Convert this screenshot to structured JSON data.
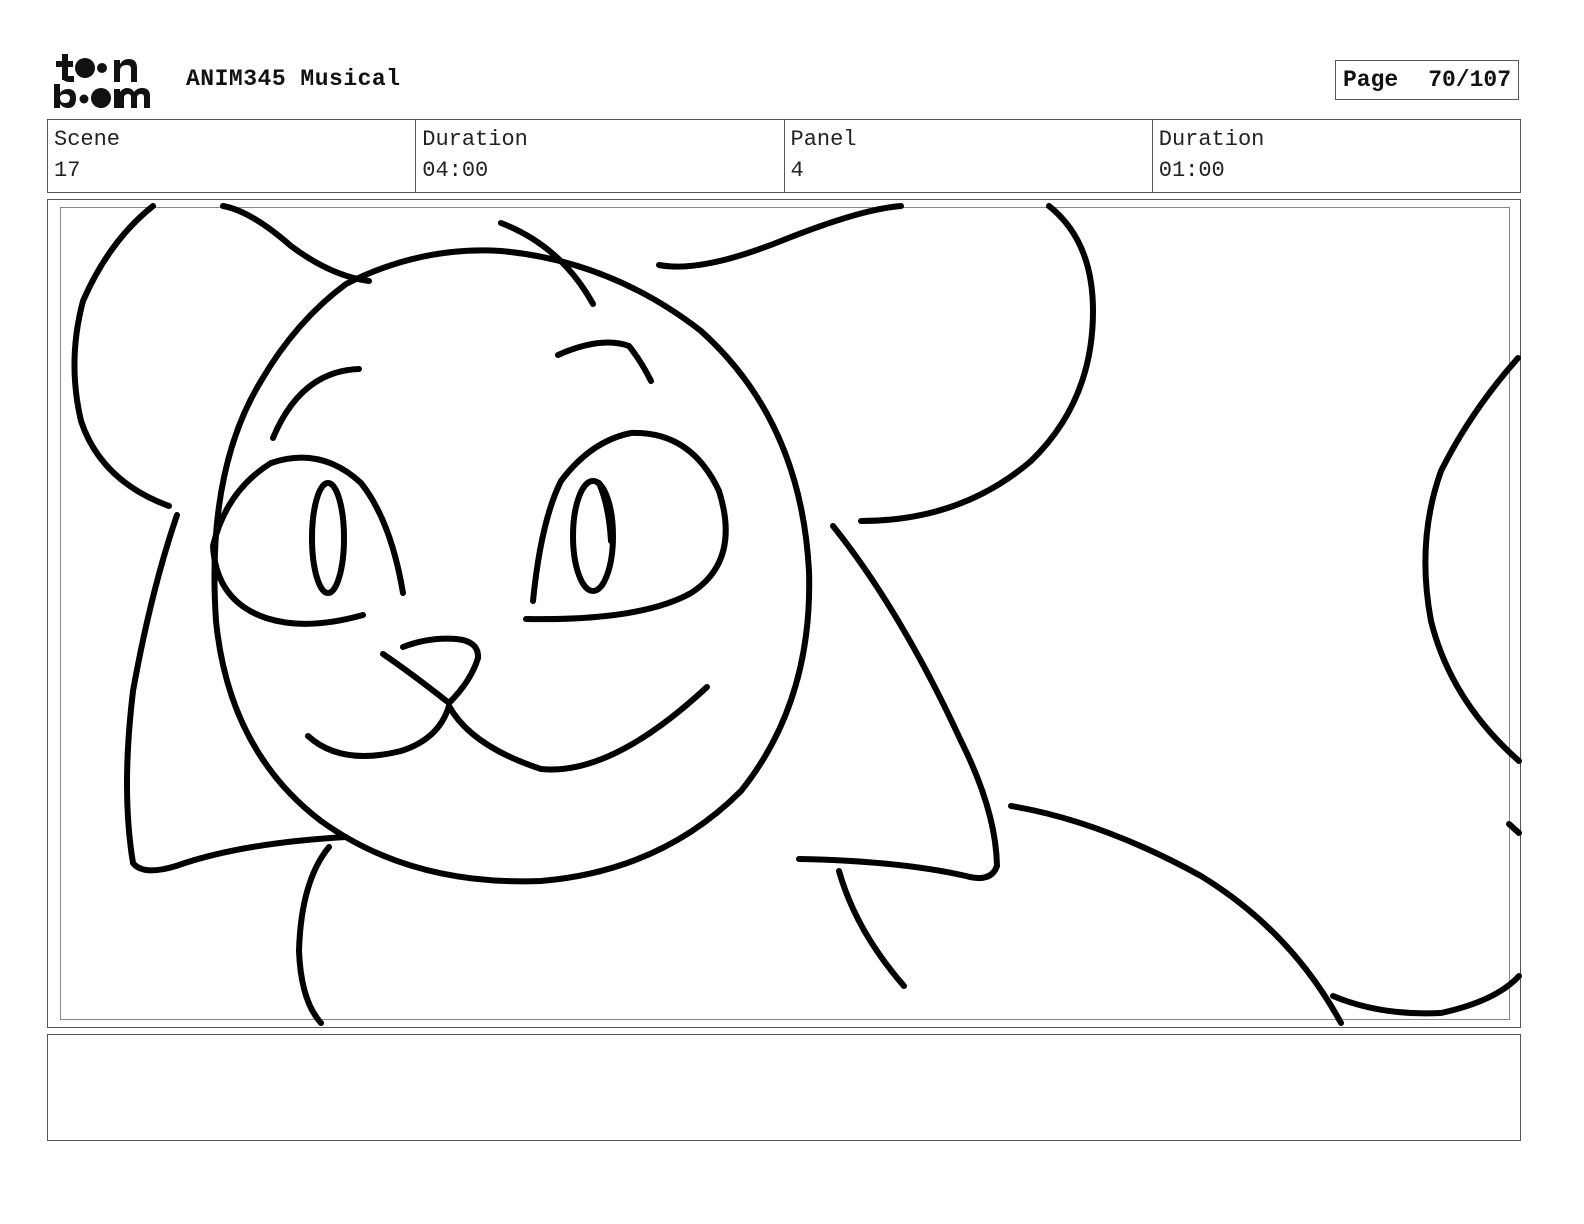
{
  "header": {
    "logo_top": "t  n",
    "logo_bottom": "b  m",
    "project_title": "ANIM345 Musical",
    "page_label": "Page",
    "page_number": "70/107"
  },
  "info": {
    "scene_label": "Scene",
    "scene_value": "17",
    "scene_duration_label": "Duration",
    "scene_duration_value": "04:00",
    "panel_label": "Panel",
    "panel_value": "4",
    "panel_duration_label": "Duration",
    "panel_duration_value": "01:00"
  },
  "notes": {
    "text": ""
  }
}
